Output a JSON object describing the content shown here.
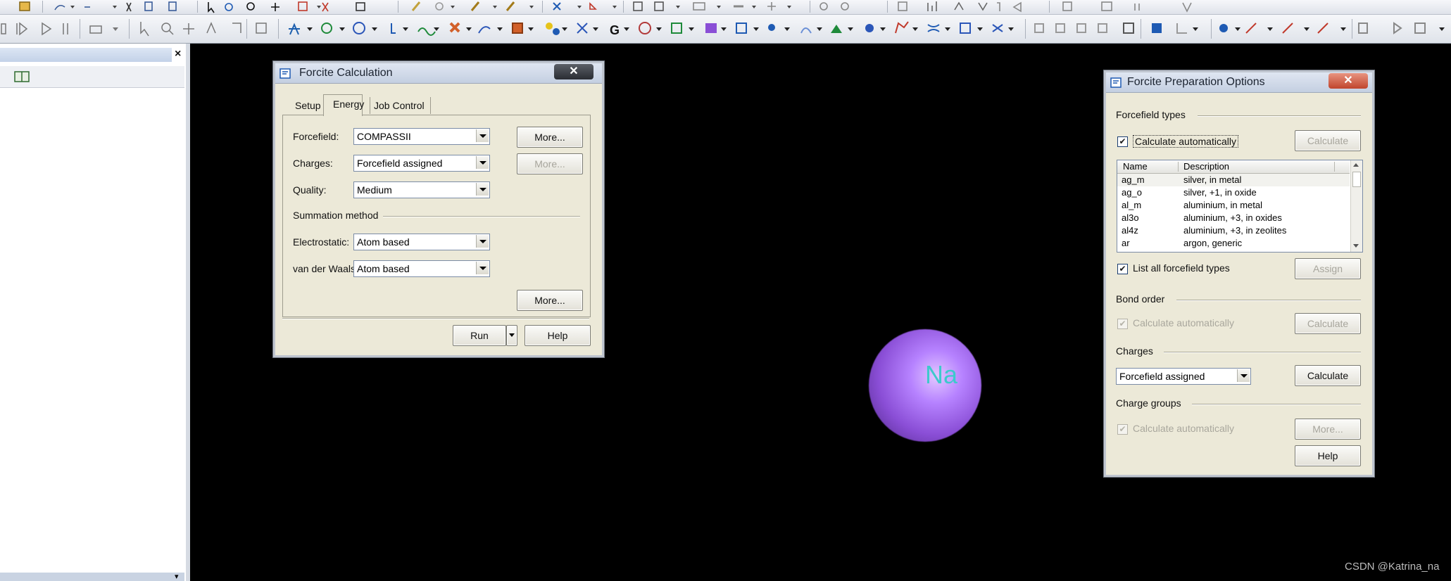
{
  "toolbar": {
    "row1_icons": [
      "open-icon",
      "undo-icon",
      "redo-icon",
      "cut-icon",
      "copy-icon",
      "paste-icon",
      "pointer-icon",
      "rotate-icon",
      "zoom-icon",
      "pan-icon",
      "delete-icon",
      "select-icon",
      "add-icon",
      "sketch-icon",
      "ring-icon",
      "pencil-icon",
      "chain-icon",
      "measure-icon",
      "clean-icon",
      "symmetry-icon",
      "grid-icon",
      "chart-icon",
      "table-icon",
      "sort-icon",
      "filter-icon",
      "window-icon"
    ],
    "row2_icons": [
      "play-icon",
      "pause-icon",
      "stop-icon",
      "record-icon",
      "mode-icon",
      "select-arrow-icon",
      "magnify-icon",
      "translate-icon",
      "rotate-arrow-icon",
      "measure-angle-icon",
      "lock-icon",
      "amorphous-cell-icon",
      "forcite-icon",
      "dmol3-icon",
      "castep-icon",
      "polymer-builder-icon",
      "mesocite-icon",
      "sorption-icon",
      "qsar-icon",
      "gulp-icon",
      "reflex-icon",
      "blends-icon",
      "conformers-icon",
      "dpd-icon",
      "morphology-icon",
      "equilibria-icon",
      "vamp-icon",
      "adsorption-locator-icon",
      "kinetix-icon",
      "synthia-icon",
      "dftb-icon",
      "qmera-icon",
      "onetep-icon",
      "cluster-icon",
      "surface-icon",
      "layer-icon",
      "box-icon",
      "display-icon",
      "sphere-icon",
      "bond-icon",
      "line-icon",
      "ribbon-icon",
      "script-icon",
      "run-icon",
      "back-icon"
    ]
  },
  "left_panel": {
    "close_symbol": "×",
    "bottom_arrow": "▾"
  },
  "forcite_calc": {
    "title": "Forcite Calculation",
    "close_symbol": "✕",
    "tabs": [
      "Setup",
      "Energy",
      "Job Control"
    ],
    "active_tab": "Energy",
    "forcefield_label": "Forcefield:",
    "forcefield_value": "COMPASSII",
    "charges_label": "Charges:",
    "charges_value": "Forcefield assigned",
    "quality_label": "Quality:",
    "quality_value": "Medium",
    "summation_label": "Summation method",
    "electrostatic_label": "Electrostatic:",
    "electrostatic_value": "Atom based",
    "vdw_label": "van der Waals:",
    "vdw_value": "Atom based",
    "more_forcefield": "More...",
    "more_charges": "More...",
    "more_summation": "More...",
    "run_label": "Run",
    "help_label": "Help"
  },
  "forcite_prep": {
    "title": "Forcite Preparation Options",
    "close_symbol": "✕",
    "forcefield_types_label": "Forcefield types",
    "calc_auto_label": "Calculate automatically",
    "calc_auto_checked": true,
    "calculate_label": "Calculate",
    "list_headers": [
      "Name",
      "Description"
    ],
    "list_rows": [
      {
        "name": "ag_m",
        "description": "silver, in metal"
      },
      {
        "name": "ag_o",
        "description": "silver, +1, in oxide"
      },
      {
        "name": "al_m",
        "description": "aluminium, in metal"
      },
      {
        "name": "al3o",
        "description": "aluminium, +3, in oxides"
      },
      {
        "name": "al4z",
        "description": "aluminium, +3, in zeolites"
      },
      {
        "name": "ar",
        "description": "argon, generic"
      }
    ],
    "list_all_label": "List all forcefield types",
    "list_all_checked": true,
    "assign_label": "Assign",
    "bond_order_label": "Bond order",
    "bond_calc_auto_label": "Calculate automatically",
    "bond_calculate_label": "Calculate",
    "charges_label": "Charges",
    "charges_value": "Forcefield assigned",
    "charges_calculate_label": "Calculate",
    "charge_groups_label": "Charge groups",
    "cg_calc_auto_label": "Calculate automatically",
    "more_label": "More...",
    "help_label": "Help"
  },
  "canvas": {
    "atom_label": "Na",
    "atom_color": "#9b5cf0",
    "label_color": "#3dc9cc",
    "watermark": "CSDN @Katrina_na"
  }
}
